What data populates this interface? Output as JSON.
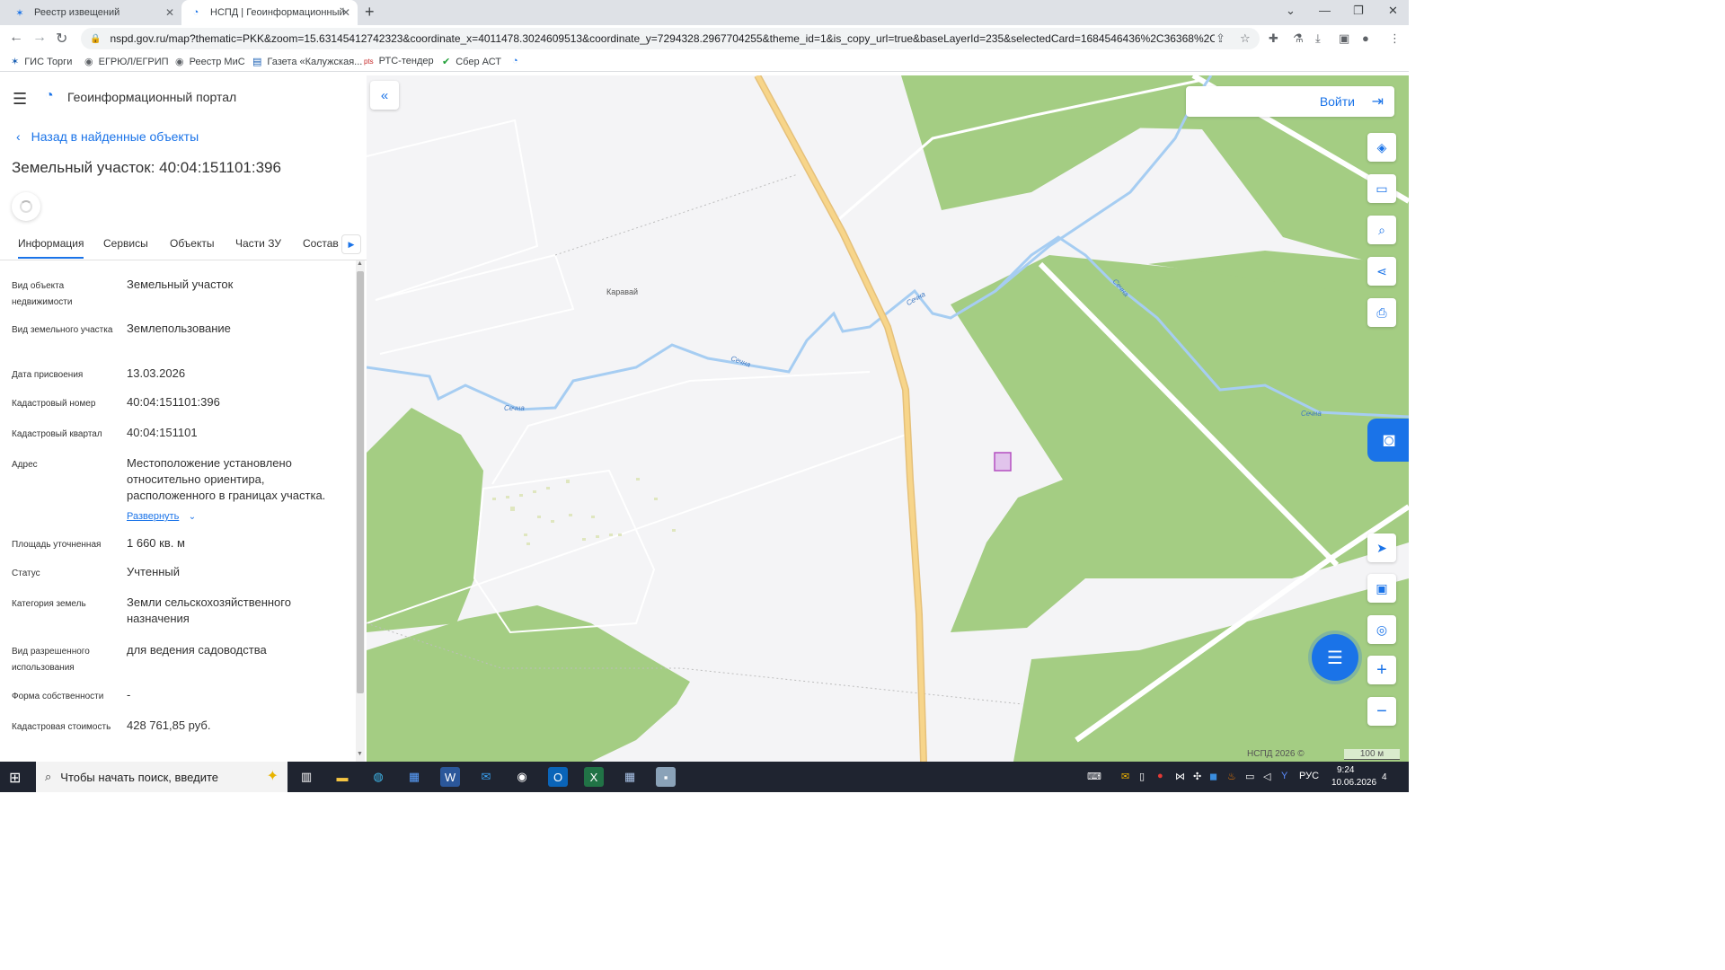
{
  "browser": {
    "tabs": [
      {
        "label": "Реестр извещений",
        "active": false
      },
      {
        "label": "НСПД | Геоинформационный п",
        "active": true
      }
    ],
    "new_tab": "+",
    "url": "nspd.gov.ru/map?thematic=PKK&zoom=15.63145412742323&coordinate_x=4011478.3024609513&coordinate_y=7294328.2967704255&theme_id=1&is_copy_url=true&baseLayerId=235&selectedCard=1684546436%2C36368%2C40%3A04%...",
    "bookmarks": [
      {
        "label": "ГИС Торги",
        "icon": "gis-icon"
      },
      {
        "label": "ЕГРЮЛ/ЕГРИП",
        "icon": "egrul-icon"
      },
      {
        "label": "Реестр МиС",
        "icon": "registry-icon"
      },
      {
        "label": "Газета «Калужская...",
        "icon": "newspaper-icon"
      },
      {
        "label": "РТС-тендер",
        "icon": "rts-icon"
      },
      {
        "label": "Сбер АСТ",
        "icon": "sber-icon"
      }
    ]
  },
  "portal": {
    "title": "Геоинформационный портал",
    "back_label": "Назад в найденные объекты",
    "object_title": "Земельный участок: 40:04:151101:396",
    "tabs": [
      "Информация",
      "Сервисы",
      "Объекты",
      "Части ЗУ",
      "Состав"
    ],
    "properties": [
      {
        "label": "Вид объекта недвижимости",
        "value": "Земельный участок"
      },
      {
        "label": "Вид земельного участка",
        "value": "Землепользование"
      },
      {
        "label": "Дата присвоения",
        "value": "13.03.2026"
      },
      {
        "label": "Кадастровый номер",
        "value": "40:04:151101:396"
      },
      {
        "label": "Кадастровый квартал",
        "value": "40:04:151101"
      },
      {
        "label": "Адрес",
        "value": "Местоположение установлено относительно ориентира, расположенного в границах участка."
      },
      {
        "label": "Площадь уточненная",
        "value": "1 660 кв. м"
      },
      {
        "label": "Статус",
        "value": "Учтенный"
      },
      {
        "label": "Категория земель",
        "value": "Земли сельскохозяйственного назначения"
      },
      {
        "label": "Вид разрешенного использования",
        "value": "для ведения садоводства"
      },
      {
        "label": "Форма собственности",
        "value": "-"
      },
      {
        "label": "Кадастровая стоимость",
        "value": "428 761,85 руб."
      }
    ],
    "expand_label": "Развернуть"
  },
  "map": {
    "login_label": "Войти",
    "labels": {
      "village": "Каравай",
      "river": "Сечна"
    },
    "attribution": "НСПД 2026 ©",
    "scale": "100 м",
    "colors": {
      "forest": "#a4cd83",
      "river": "#a6cdf2",
      "road": "#f7d58a",
      "parcel": "#b44fc0",
      "accent": "#1a73e8"
    }
  },
  "taskbar": {
    "search_placeholder": "Чтобы начать поиск, введите",
    "language": "РУС",
    "time": "9:24",
    "date": "10.06.2026",
    "notifications": "4"
  }
}
